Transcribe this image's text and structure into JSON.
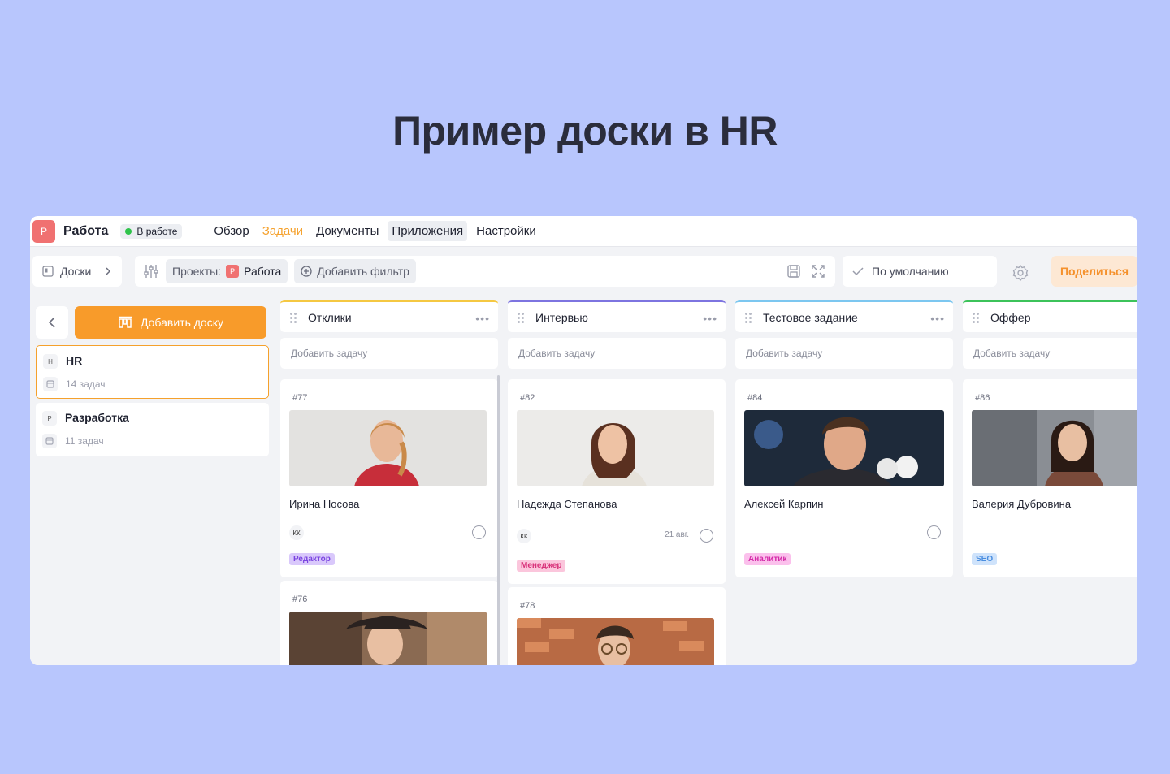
{
  "headline": "Пример доски в HR",
  "topbar": {
    "project_icon": "Р",
    "project_title": "Работа",
    "status": "В работе",
    "nav": [
      "Обзор",
      "Задачи",
      "Документы",
      "Приложения",
      "Настройки"
    ]
  },
  "toolbar": {
    "boards_label": "Доски",
    "projects_label": "Проекты:",
    "project_chip_icon": "Р",
    "project_chip": "Работа",
    "add_filter": "Добавить фильтр",
    "default_view": "По умолчанию",
    "share": "Поделиться"
  },
  "sidebar": {
    "add_board": "Добавить доску",
    "boards": [
      {
        "letter": "H",
        "name": "HR",
        "count": "14 задач"
      },
      {
        "letter": "Р",
        "name": "Разработка",
        "count": "11 задач"
      }
    ]
  },
  "columns": [
    {
      "title": "Отклики",
      "color": "#f5c842",
      "add_task": "Добавить задачу",
      "cards": [
        {
          "id": "#77",
          "name": "Ирина Носова",
          "user": "КК",
          "date": "",
          "tag": "Редактор",
          "tag_bg": "#d9c8fb",
          "tag_fg": "#7b45e0"
        },
        {
          "id": "#76",
          "name": "",
          "user": "",
          "date": "",
          "tag": ""
        }
      ]
    },
    {
      "title": "Интервью",
      "color": "#7d74e0",
      "add_task": "Добавить задачу",
      "cards": [
        {
          "id": "#82",
          "name": "Надежда Степанова",
          "user": "КК",
          "date": "21 авг.",
          "tag": "Менеджер",
          "tag_bg": "#fbc6dc",
          "tag_fg": "#d8327a"
        },
        {
          "id": "#78",
          "name": "",
          "user": "",
          "date": "",
          "tag": ""
        }
      ]
    },
    {
      "title": "Тестовое задание",
      "color": "#7cc7f0",
      "add_task": "Добавить задачу",
      "cards": [
        {
          "id": "#84",
          "name": "Алексей Карпин",
          "user": "",
          "date": "",
          "tag": "Аналитик",
          "tag_bg": "#fbc0ec",
          "tag_fg": "#d42aa8"
        }
      ]
    },
    {
      "title": "Оффер",
      "color": "#3cc35a",
      "add_task": "Добавить задачу",
      "cards": [
        {
          "id": "#86",
          "name": "Валерия Дубровина",
          "user": "",
          "date": "",
          "tag": "SEO",
          "tag_bg": "#cfe3fb",
          "tag_fg": "#4a8ee0"
        }
      ]
    }
  ]
}
